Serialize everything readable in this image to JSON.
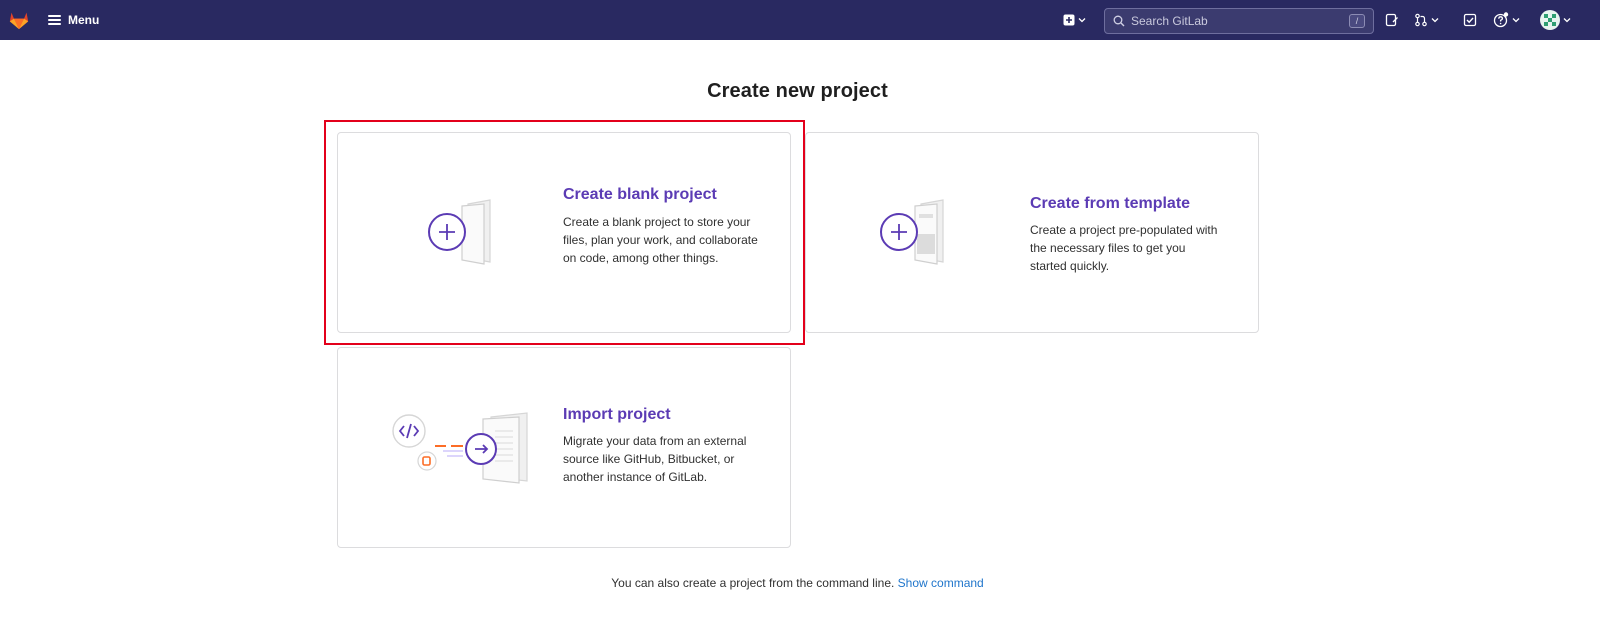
{
  "navbar": {
    "menu_label": "Menu",
    "search_placeholder": "Search GitLab",
    "search_shortcut": "/"
  },
  "page": {
    "title": "Create new project"
  },
  "cards": {
    "blank": {
      "title": "Create blank project",
      "description": "Create a blank project to store your files, plan your work, and collaborate on code, among other things."
    },
    "template": {
      "title": "Create from template",
      "description": "Create a project pre-populated with the necessary files to get you started quickly."
    },
    "import": {
      "title": "Import project",
      "description": "Migrate your data from an external source like GitHub, Bitbucket, or another instance of GitLab."
    }
  },
  "footer": {
    "text": "You can also create a project from the command line.",
    "link": "Show command"
  },
  "colors": {
    "navbar": "#292961",
    "accent": "#5b3bb4",
    "link": "#1f75cb",
    "highlight": "#e3001b"
  }
}
